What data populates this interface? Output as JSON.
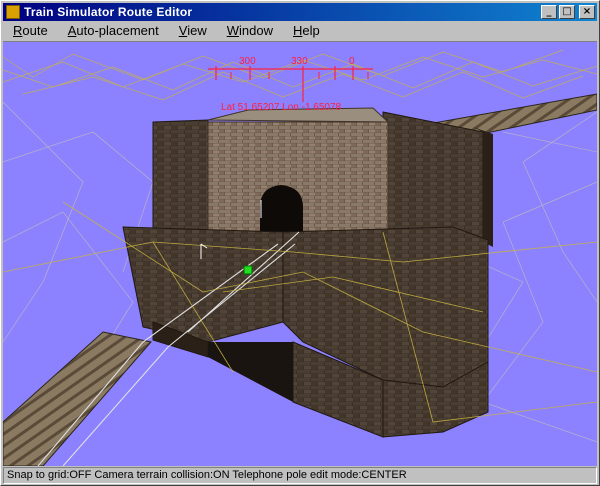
{
  "window": {
    "title": "Train Simulator Route Editor",
    "caption_buttons": {
      "minimize": "_",
      "maximize": "□",
      "close": "×"
    }
  },
  "menu": {
    "items": [
      {
        "first": "R",
        "rest": "oute"
      },
      {
        "first": "A",
        "rest": "uto-placement"
      },
      {
        "first": "V",
        "rest": "iew"
      },
      {
        "first": "W",
        "rest": "indow"
      },
      {
        "first": "H",
        "rest": "elp"
      }
    ]
  },
  "compass": {
    "labels": [
      "300",
      "330",
      "0"
    ],
    "lat_lon": "Lat 51.65207 Lon -1.65078",
    "color": "#ff2040"
  },
  "viewport": {
    "sky_color": "#8c82ff",
    "wire_color": "#c8b440",
    "track_color": "#9a8a70",
    "scene": "brick-tunnel-portal"
  },
  "status": {
    "text": "Snap to grid:OFF Camera terrain collision:ON Telephone pole edit mode:CENTER"
  },
  "colors": {
    "title_start": "#000080",
    "title_end": "#1084d0",
    "marker": "#22dd22"
  }
}
